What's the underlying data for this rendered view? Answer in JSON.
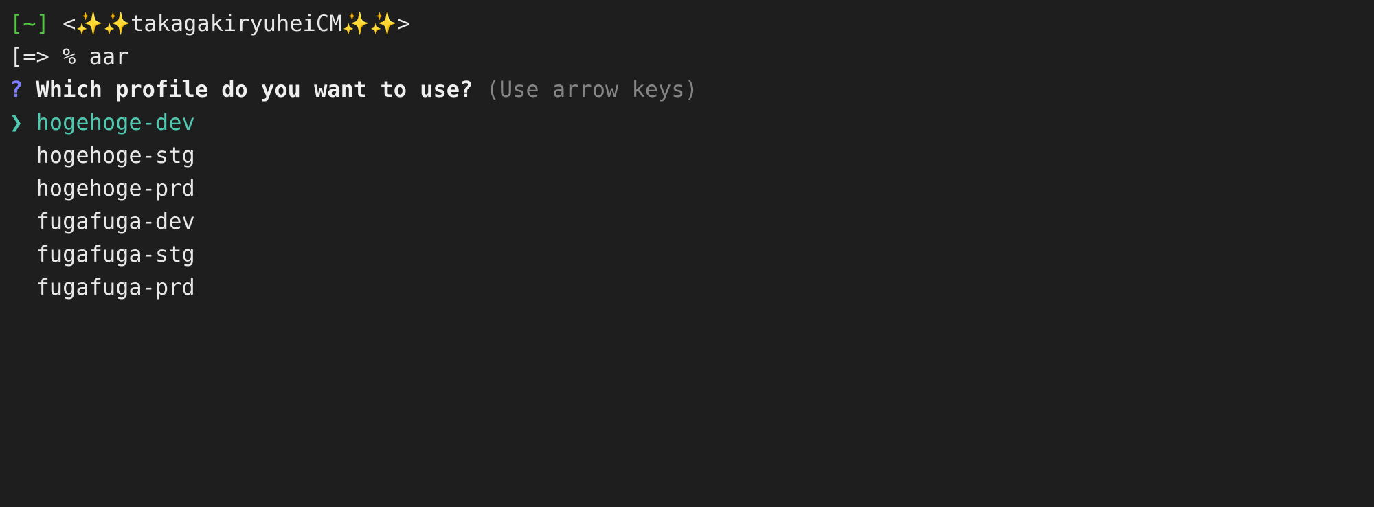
{
  "prompt": {
    "bracket_open": "[",
    "tilde": "~",
    "bracket_close": "]",
    "angle_open": " <",
    "sparkle": "✨✨",
    "username": "takagakiryuheiCM",
    "sparkle2": "✨✨",
    "angle_close": ">",
    "line2_prefix": "[=> % ",
    "command": "aar"
  },
  "question": {
    "mark": "?",
    "text": "Which profile do you want to use?",
    "hint": "(Use arrow keys)"
  },
  "pointer": "❯",
  "options": [
    "hogehoge-dev",
    "hogehoge-stg",
    "hogehoge-prd",
    "fugafuga-dev",
    "fugafuga-stg",
    "fugafuga-prd"
  ],
  "selected_index": 0
}
